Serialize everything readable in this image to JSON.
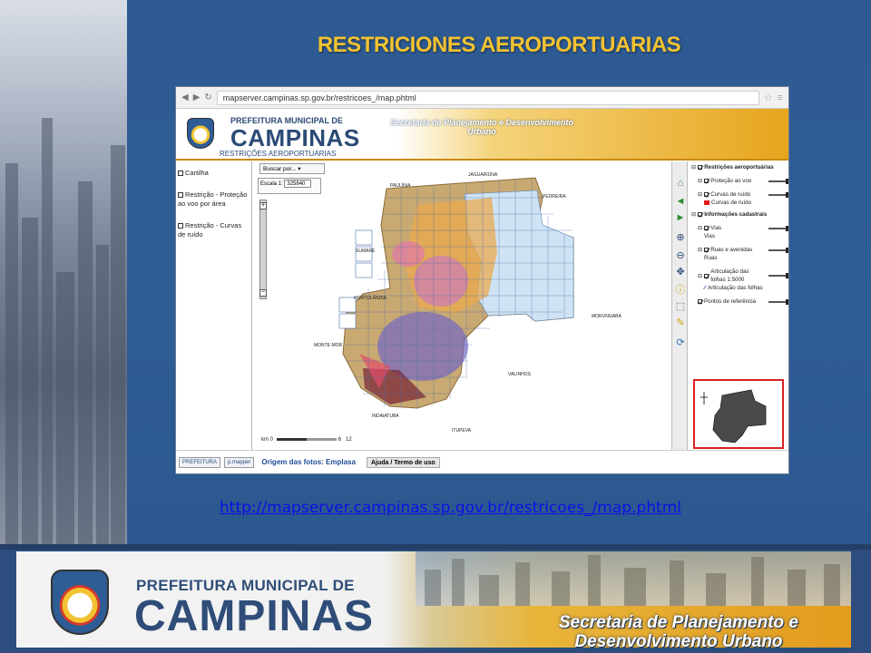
{
  "slide": {
    "title": "RESTRICIONES AEROPORTUARIAS",
    "link": "http://mapserver.campinas.sp.gov.br/restricoes_/map.phtml"
  },
  "browser": {
    "url": "mapserver.campinas.sp.gov.br/restricoes_/map.phtml"
  },
  "site_header": {
    "org_small": "PREFEITURA MUNICIPAL DE",
    "org_big": "CAMPINAS",
    "subtitle": "RESTRIÇÕES AEROPORTUÁRIAS",
    "secretariat": "Secretaria de Planejamento e Desenvolvimento Urbano"
  },
  "left_panel": {
    "items": [
      {
        "label": "Cartilha"
      },
      {
        "label": "Restrição - Proteção ao voo por área"
      },
      {
        "label": "Restrição - Curvas de ruído"
      }
    ]
  },
  "map": {
    "search_label": "Buscar por...",
    "scale_label": "Escala 1:",
    "scale_value": "325840",
    "km_start": "km 0",
    "km_mid": "6",
    "km_end": "12",
    "places": [
      "JAGUARIÚNA",
      "PAULÍNIA",
      "PEDREIRA",
      "SUMARÉ",
      "HORTOLÂNDIA",
      "MORUNGABA",
      "MONTE MOR",
      "VALINHOS",
      "INDAIATUBA",
      "ITUPEVA"
    ]
  },
  "legend": {
    "group1": "Restrições aeroportuárias",
    "g1_items": [
      "Proteção ao voo",
      "Curvas de ruído"
    ],
    "g1_sub": "Curvas de ruído",
    "group2": "Informações cadastrais",
    "vias": "Vias",
    "vias_sub": "Vias",
    "ruas": "Ruas e avenidas",
    "ruas_sub": "Ruas",
    "articulacao": "Articulação das folhas 1:5000",
    "articulacao_sub": "Articulação das folhas",
    "pontos": "Pontos de referência",
    "colors": {
      "curvas": "#e31a1c"
    }
  },
  "statusbar": {
    "chip1": "PREFEITURA",
    "chip2": "p.mapper",
    "origin": "Origem das fotos: Emplasa",
    "help": "Ajuda / Termo de uso"
  },
  "footer": {
    "org_small": "PREFEITURA MUNICIPAL DE",
    "org_big": "CAMPINAS",
    "secretariat_line1": "Secretaria de Planejamento e",
    "secretariat_line2": "Desenvolvimento Urbano"
  },
  "colors": {
    "title": "#f2c230",
    "slide_bg": "#2e5c95",
    "link": "#0f0fe6"
  }
}
